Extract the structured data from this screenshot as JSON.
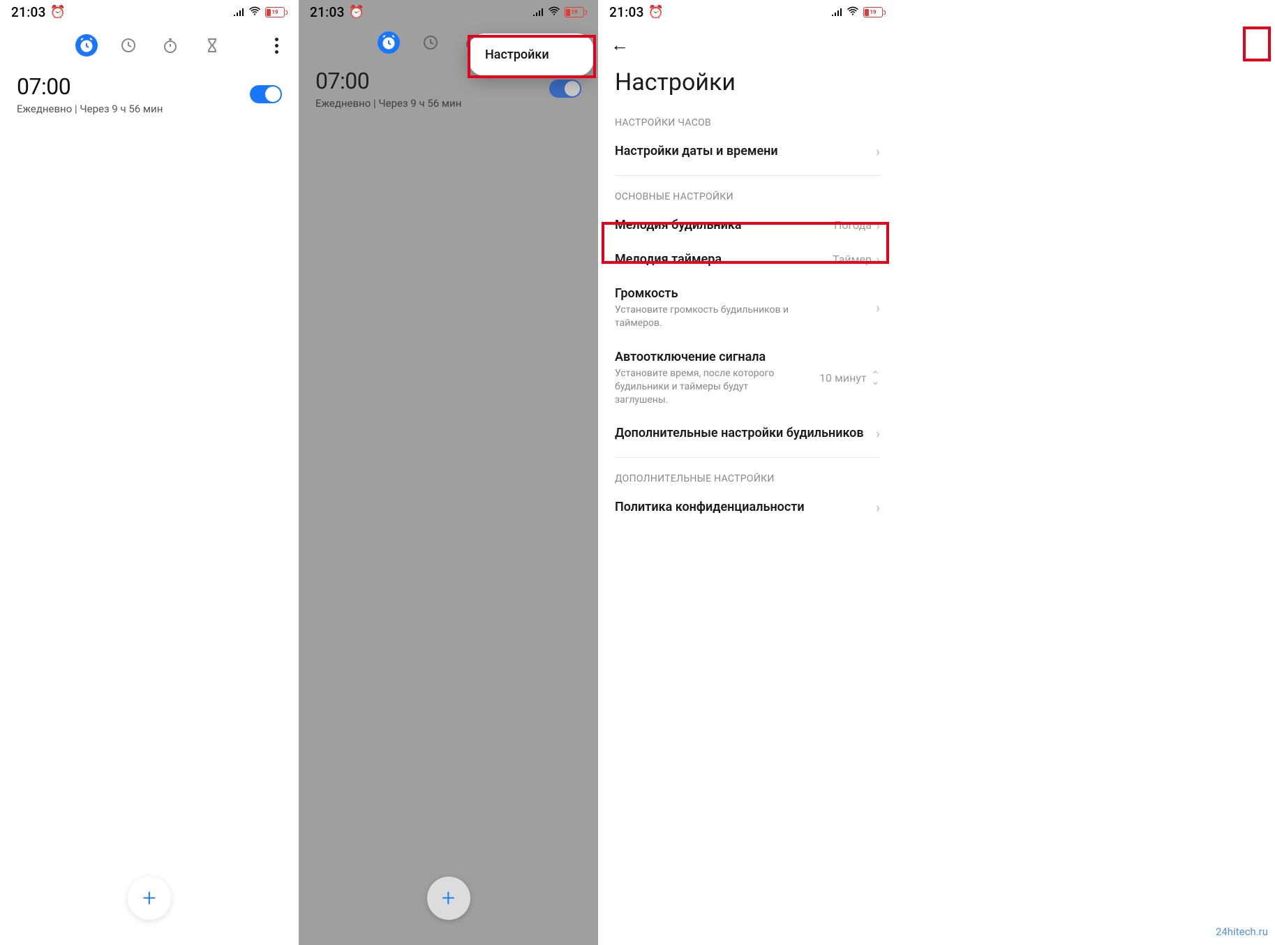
{
  "status": {
    "time": "21:03",
    "battery_pct": "19"
  },
  "tabs": {
    "alarm": "alarm",
    "clock": "clock",
    "stopwatch": "stopwatch",
    "timer": "timer"
  },
  "alarm": {
    "time": "07:00",
    "subtitle": "Ежедневно  |  Через 9 ч 56 мин"
  },
  "popup": {
    "settings": "Настройки"
  },
  "settings_page": {
    "title": "Настройки",
    "section_clock": "НАСТРОЙКИ ЧАСОВ",
    "date_time": "Настройки даты и времени",
    "section_main": "ОСНОВНЫЕ НАСТРОЙКИ",
    "alarm_sound": {
      "label": "Мелодия будильника",
      "value": "Погода"
    },
    "timer_sound": {
      "label": "Мелодия таймера",
      "value": "Таймер"
    },
    "volume": {
      "label": "Громкость",
      "desc": "Установите громкость будильников и таймеров."
    },
    "auto_off": {
      "label": "Автоотключение сигнала",
      "desc": "Установите время, после которого будильники и таймеры будут заглушены.",
      "value": "10 минут"
    },
    "extra_alarm": "Дополнительные настройки будильников",
    "section_extra": "ДОПОЛНИТЕЛЬНЫЕ НАСТРОЙКИ",
    "privacy": "Политика конфиденциальности"
  },
  "watermark": "24hitech.ru"
}
